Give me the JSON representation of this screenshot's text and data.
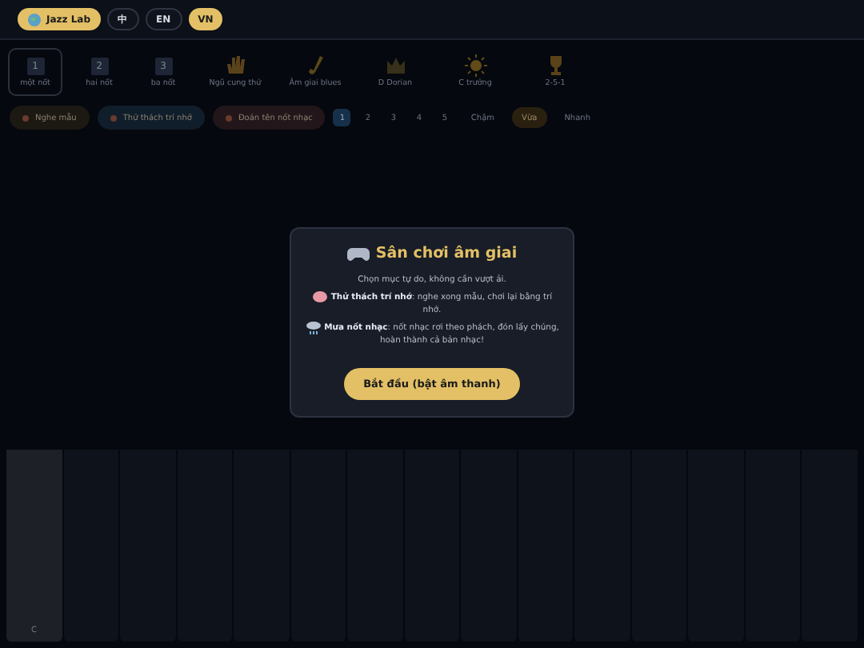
{
  "topbar": {
    "logo": "Jazz Lab",
    "languages": [
      {
        "label": "中",
        "selected": false
      },
      {
        "label": "EN",
        "selected": false
      },
      {
        "label": "VN",
        "selected": true
      }
    ]
  },
  "tabs": [
    {
      "kind": "digit",
      "glyph": "1",
      "label": "một nốt",
      "selected": true
    },
    {
      "kind": "digit",
      "glyph": "2",
      "label": "hai nốt",
      "selected": false
    },
    {
      "kind": "digit",
      "glyph": "3",
      "label": "ba nốt",
      "selected": false
    },
    {
      "kind": "hand",
      "label": "Ngũ cung thứ",
      "selected": false
    },
    {
      "kind": "sax",
      "label": "Âm giai blues",
      "selected": false
    },
    {
      "kind": "crown",
      "label": "D Dorian",
      "selected": false
    },
    {
      "kind": "sun",
      "label": "C trưởng",
      "selected": false
    },
    {
      "kind": "trophy",
      "label": "2-5-1",
      "selected": false
    }
  ],
  "modes": [
    {
      "label": "Nghe mẫu",
      "color": "#1c1812"
    },
    {
      "label": "Thử thách trí nhớ",
      "color": "#101d2a"
    },
    {
      "label": "Đoán tên nốt nhạc",
      "color": "#22161a"
    }
  ],
  "levels": [
    {
      "label": "1",
      "selected": true
    },
    {
      "label": "2",
      "selected": false
    },
    {
      "label": "3",
      "selected": false
    },
    {
      "label": "4",
      "selected": false
    },
    {
      "label": "5",
      "selected": false
    }
  ],
  "speeds": [
    {
      "label": "Chậm",
      "selected": false
    },
    {
      "label": "Vừa",
      "selected": true
    },
    {
      "label": "Nhanh",
      "selected": false
    }
  ],
  "keys": [
    {
      "label": "C",
      "active": true
    },
    {
      "active": false
    },
    {
      "active": false
    },
    {
      "active": false
    },
    {
      "active": false
    },
    {
      "active": false
    },
    {
      "active": false
    },
    {
      "active": false
    },
    {
      "active": false
    },
    {
      "active": false
    },
    {
      "active": false
    },
    {
      "active": false
    },
    {
      "active": false
    },
    {
      "active": false
    },
    {
      "active": false
    }
  ],
  "modal": {
    "title": "Sân chơi âm giai",
    "lines": [
      {
        "kind": "plain",
        "text": "Chọn mục tự do, không cần vượt ải."
      },
      {
        "kind": "memory",
        "text": "**Thử thách trí nhớ**: nghe xong mẫu, chơi lại bằng trí nhớ."
      },
      {
        "kind": "rain",
        "text": "**Mưa nốt nhạc**: nốt nhạc rơi theo phách, đón lấy chúng, hoàn thành cả bản nhạc!"
      }
    ],
    "button": "Bắt đầu (bật âm thanh)"
  }
}
